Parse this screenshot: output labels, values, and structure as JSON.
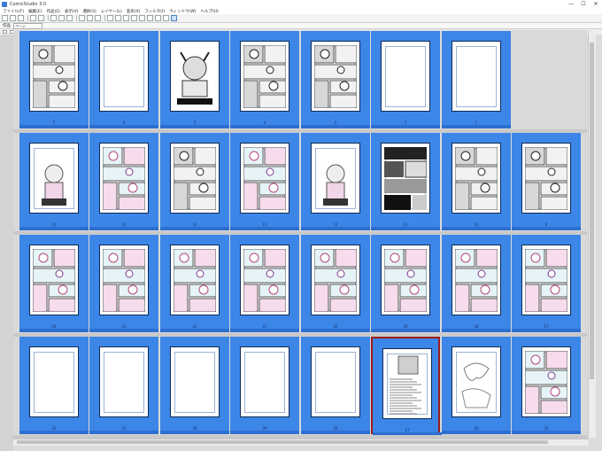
{
  "window": {
    "title": "ComicStudio 3.0",
    "controls": [
      "—",
      "☐",
      "✕"
    ]
  },
  "menu": [
    "ファイル(F)",
    "編集(E)",
    "作品(S)",
    "表示(V)",
    "選択(S)",
    "レイヤー(L)",
    "変形(X)",
    "フィルタ(I)",
    "ウィンドウ(W)",
    "ヘルプ(H)"
  ],
  "pagebar": {
    "label": "作品",
    "field": "ページ"
  },
  "accent": "#3c86e8",
  "selected_color": "#9b1b1b",
  "rows": [
    {
      "pages": [
        {
          "num": "7",
          "art": "comic"
        },
        {
          "num": "6",
          "art": "blank"
        },
        {
          "num": "5",
          "art": "cover"
        },
        {
          "num": "4",
          "art": "comic"
        },
        {
          "num": "3",
          "art": "comic"
        },
        {
          "num": "2",
          "art": "blank"
        },
        {
          "num": "1",
          "art": "blank"
        }
      ]
    },
    {
      "pages": [
        {
          "num": "16",
          "art": "single"
        },
        {
          "num": "15",
          "art": "color"
        },
        {
          "num": "14",
          "art": "comic"
        },
        {
          "num": "13",
          "art": "color"
        },
        {
          "num": "12",
          "art": "single"
        },
        {
          "num": "11",
          "art": "dark"
        },
        {
          "num": "10",
          "art": "comic"
        },
        {
          "num": "9",
          "art": "comic"
        }
      ]
    },
    {
      "pages": [
        {
          "num": "24",
          "art": "color"
        },
        {
          "num": "23",
          "art": "color"
        },
        {
          "num": "22",
          "art": "color"
        },
        {
          "num": "21",
          "art": "color"
        },
        {
          "num": "20",
          "art": "color"
        },
        {
          "num": "19",
          "art": "color"
        },
        {
          "num": "18",
          "art": "color"
        },
        {
          "num": "17",
          "art": "color"
        }
      ]
    },
    {
      "pages": [
        {
          "num": "32",
          "art": "blank"
        },
        {
          "num": "31",
          "art": "blank"
        },
        {
          "num": "30",
          "art": "blank"
        },
        {
          "num": "29",
          "art": "blank"
        },
        {
          "num": "28",
          "art": "blank"
        },
        {
          "num": "27",
          "art": "text",
          "selected": true
        },
        {
          "num": "26",
          "art": "sketch"
        },
        {
          "num": "25",
          "art": "color"
        }
      ]
    }
  ]
}
